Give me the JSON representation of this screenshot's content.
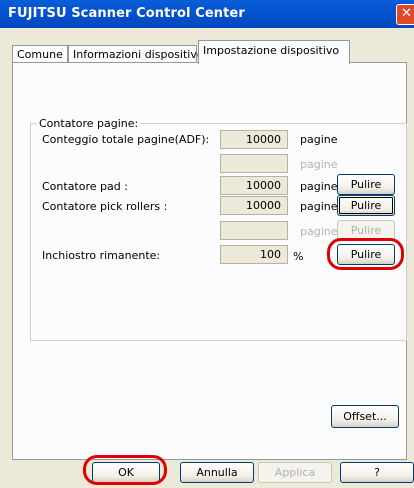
{
  "window": {
    "title": "FUJITSU Scanner Control Center",
    "close_glyph": "✕"
  },
  "tabs": [
    {
      "label": "Comune"
    },
    {
      "label": "Informazioni dispositivo"
    },
    {
      "label": "Impostazione dispositivo",
      "active": true
    }
  ],
  "group": {
    "title": "Contatore pagine:"
  },
  "rows": [
    {
      "label": "Conteggio totale pagine(ADF):",
      "value": "10000",
      "unit": "pagine"
    },
    {
      "label": "",
      "value": "",
      "unit": "pagine",
      "disabled": true
    },
    {
      "label": "Contatore pad :",
      "value": "10000",
      "unit": "pagine",
      "button": "Pulire"
    },
    {
      "label": "Contatore pick rollers :",
      "value": "10000",
      "unit": "pagine",
      "button": "Pulire"
    },
    {
      "label": "",
      "value": "",
      "unit": "pagine",
      "button": "Pulire",
      "disabled": true
    },
    {
      "label": "Inchiostro rimanente:",
      "value": "100",
      "unit": "%",
      "button": "Pulire"
    }
  ],
  "buttons": {
    "offset": "Offset...",
    "ok": "OK",
    "cancel": "Annulla",
    "apply": "Applica",
    "help": "?"
  },
  "colors": {
    "highlight_ring": "#e00000",
    "titlebar": "#0553d0"
  }
}
